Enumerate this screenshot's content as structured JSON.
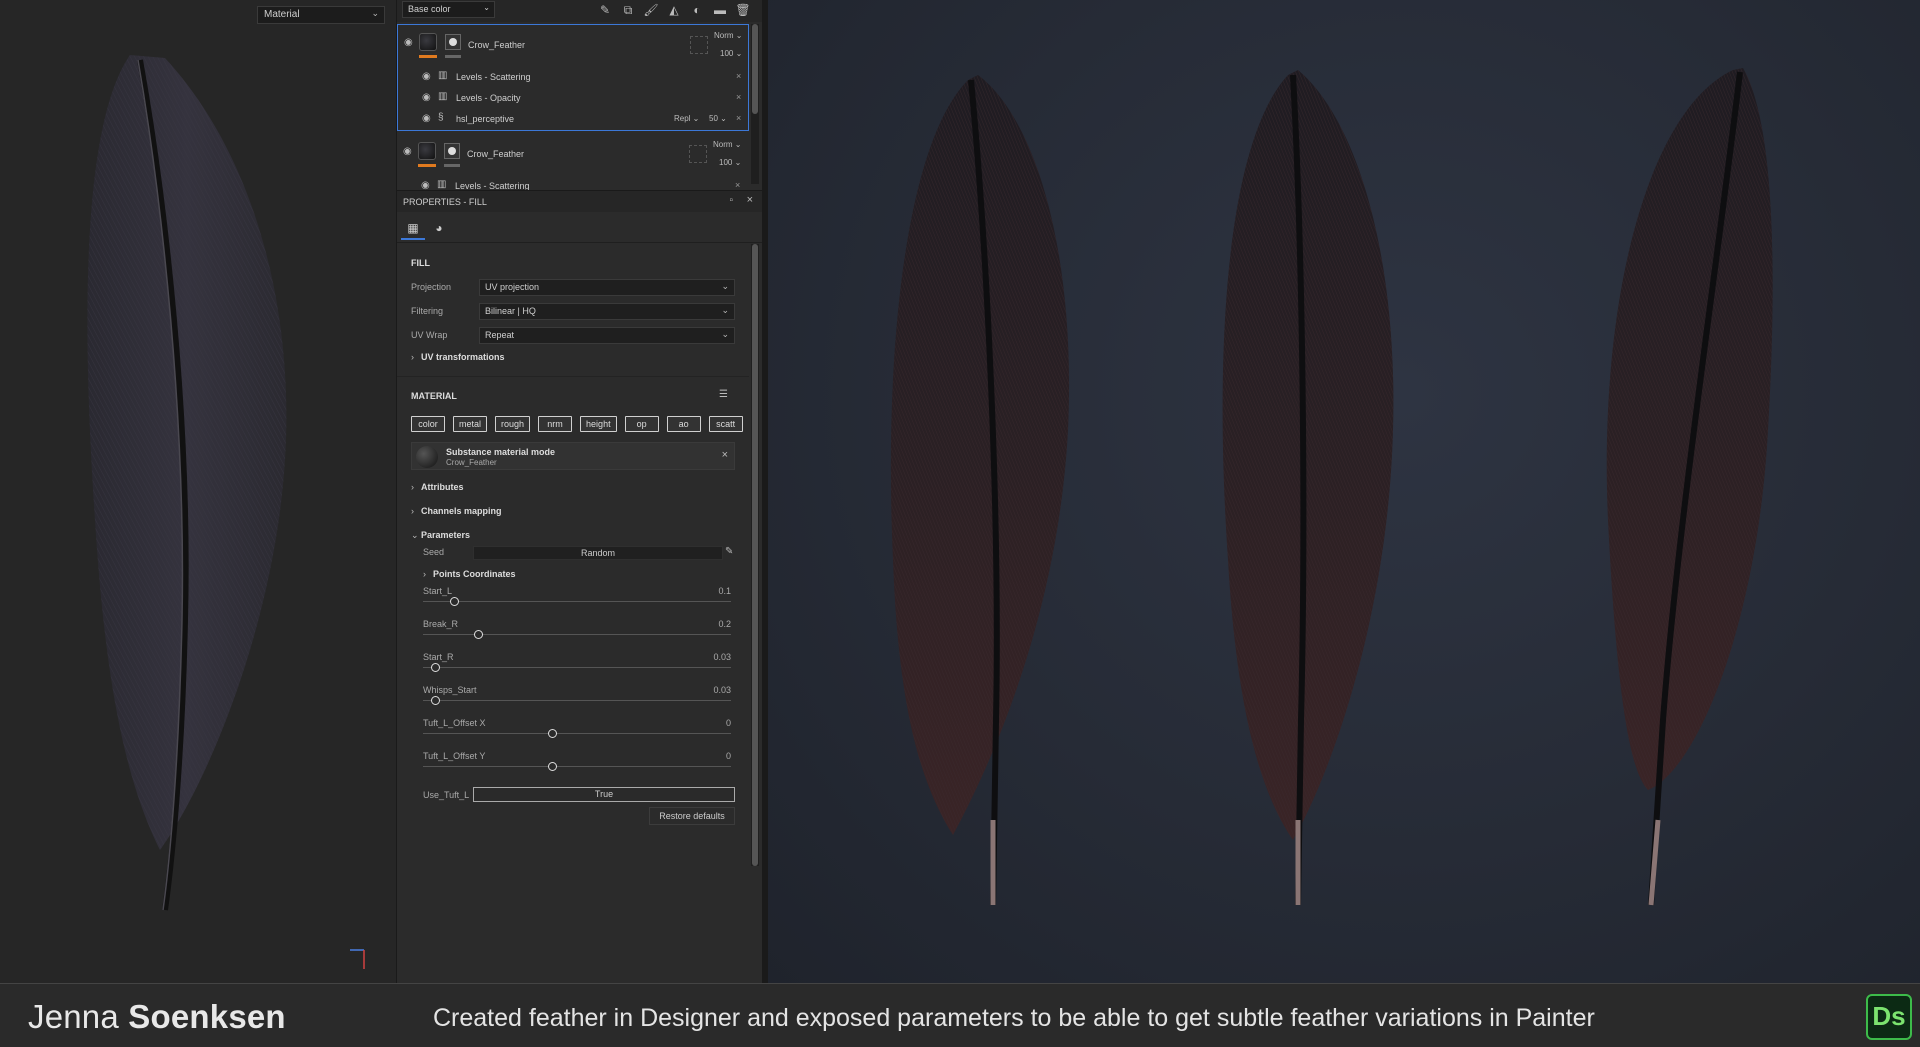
{
  "viewport2d": {
    "channel_dropdown": "Material"
  },
  "layers_panel": {
    "channel_dropdown": "Base color",
    "groups": [
      {
        "name": "Crow_Feather",
        "blend_mode": "Norm",
        "opacity": "100",
        "selected": true,
        "effects": [
          {
            "name": "Levels - Scattering",
            "icon": "levels-icon"
          },
          {
            "name": "Levels - Opacity",
            "icon": "levels-icon"
          },
          {
            "name": "hsl_perceptive",
            "icon": "filter-icon",
            "blend_mode": "Repl",
            "opacity": "50"
          }
        ]
      },
      {
        "name": "Crow_Feather",
        "blend_mode": "Norm",
        "opacity": "100",
        "selected": false,
        "effects": [
          {
            "name": "Levels - Scattering",
            "icon": "levels-icon"
          }
        ]
      }
    ]
  },
  "properties": {
    "header": "PROPERTIES - FILL",
    "fill": {
      "title": "FILL",
      "projection_label": "Projection",
      "projection_value": "UV projection",
      "filtering_label": "Filtering",
      "filtering_value": "Bilinear | HQ",
      "uvwrap_label": "UV Wrap",
      "uvwrap_value": "Repeat",
      "uv_transformations": "UV transformations"
    },
    "material": {
      "title": "MATERIAL",
      "channels": [
        "color",
        "metal",
        "rough",
        "nrm",
        "height",
        "op",
        "ao",
        "scatt"
      ],
      "mode_title": "Substance material mode",
      "mode_material": "Crow_Feather",
      "attributes": "Attributes",
      "channels_mapping": "Channels mapping",
      "parameters": "Parameters",
      "seed_label": "Seed",
      "seed_value": "Random",
      "points_coordinates": "Points Coordinates",
      "sliders": [
        {
          "label": "Start_L",
          "value": "0.1",
          "fraction": 0.1
        },
        {
          "label": "Break_R",
          "value": "0.2",
          "fraction": 0.18
        },
        {
          "label": "Start_R",
          "value": "0.03",
          "fraction": 0.04
        },
        {
          "label": "Whisps_Start",
          "value": "0.03",
          "fraction": 0.04
        },
        {
          "label": "Tuft_L_Offset X",
          "value": "0",
          "fraction": 0.42
        },
        {
          "label": "Tuft_L_Offset Y",
          "value": "0",
          "fraction": 0.42
        }
      ],
      "use_tuft_label": "Use_Tuft_L",
      "use_tuft_value": "True",
      "restore_defaults": "Restore defaults"
    }
  },
  "footer": {
    "first_name": "Jenna",
    "last_name": "Soenksen",
    "description": "Created feather in Designer and exposed parameters to be able to get subtle feather variations in Painter",
    "logo": "Ds"
  },
  "colors": {
    "accent_blue": "#3c78d8",
    "layer_orange": "#e07a1f",
    "logo_green": "#3dbb4a"
  }
}
